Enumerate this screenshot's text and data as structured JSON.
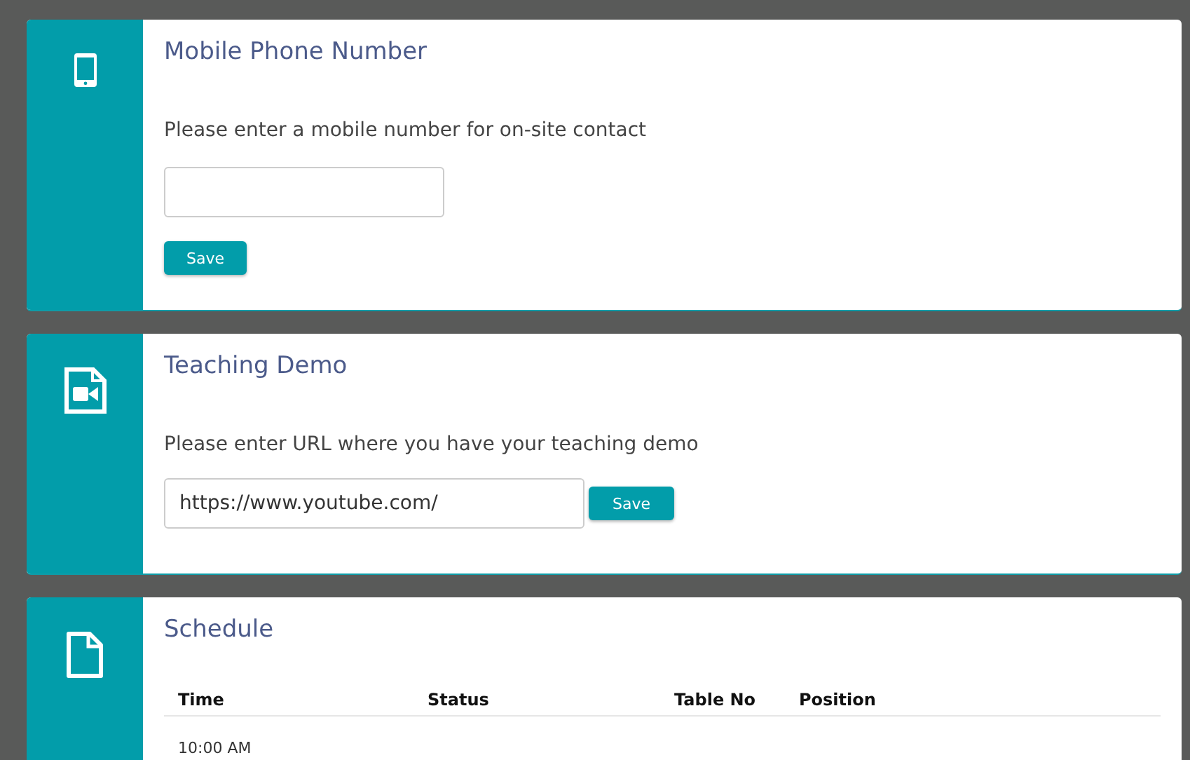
{
  "sections": [
    {
      "kind": "phone",
      "title": "Mobile Phone Number",
      "form": {
        "prompt": "Please enter a mobile number for on-site contact",
        "button": "Save",
        "inline": false
      }
    },
    {
      "kind": "video",
      "title": "Teaching Demo",
      "form": {
        "prompt": "Please enter URL where you have your teaching demo",
        "value": "https://www.youtube.com/",
        "button": "Save",
        "inline": true
      }
    },
    {
      "kind": "schedule",
      "title": "Schedule",
      "table": {
        "columns": [
          "Time",
          "Status",
          "Table No",
          "Position"
        ],
        "rows": [
          [
            "10:00 AM"
          ]
        ]
      }
    }
  ]
}
